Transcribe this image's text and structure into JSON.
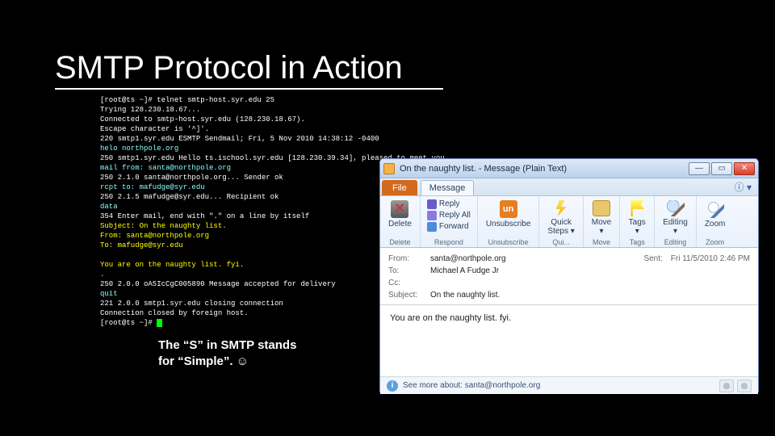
{
  "title": "SMTP Protocol in Action",
  "caption_l1": "The “S” in SMTP stands",
  "caption_l2": "for “Simple”. ☺",
  "terminal": {
    "l01": "[root@ts ~]# telnet smtp-host.syr.edu 25",
    "l02": "Trying 128.230.18.67...",
    "l03": "Connected to smtp-host.syr.edu (128.230.18.67).",
    "l04": "Escape character is '^]'.",
    "l05": "220 smtp1.syr.edu ESMTP Sendmail; Fri, 5 Nov 2010 14:38:12 -0400",
    "l06": "helo northpole.org",
    "l07": "250 smtp1.syr.edu Hello ts.ischool.syr.edu [128.230.39.34], pleased to meet you",
    "l08": "mail from: santa@northpole.org",
    "l09": "250 2.1.0 santa@northpole.org... Sender ok",
    "l10": "rcpt to: mafudge@syr.edu",
    "l11": "250 2.1.5 mafudge@syr.edu... Recipient ok",
    "l12": "data",
    "l13": "354 Enter mail, end with \".\" on a line by itself",
    "l14": "Subject: On the naughty list.",
    "l15": "From: santa@northpole.org",
    "l16": "To: mafudge@syr.edu",
    "l17": "",
    "l18": "You are on the naughty list. fyi.",
    "l19": ".",
    "l20": "250 2.0.0 oA5IcCgC005890 Message accepted for delivery",
    "l21": "quit",
    "l22": "221 2.0.0 smtp1.syr.edu closing connection",
    "l23": "Connection closed by foreign host.",
    "l24": "[root@ts ~]# "
  },
  "outlook": {
    "window_title": "On the naughty list. - Message (Plain Text)",
    "tabs": {
      "file": "File",
      "message": "Message"
    },
    "ribbon": {
      "delete_grp": "Delete",
      "delete": "Delete",
      "respond_grp": "Respond",
      "reply": "Reply",
      "replyall": "Reply All",
      "forward": "Forward",
      "unsub_grp": "Unsubscribe",
      "unsubscribe": "Unsubscribe",
      "qui_grp": "Qui...",
      "quicksteps": "Quick\nSteps ▾",
      "move_grp": "Move",
      "move": "Move\n▾",
      "tags_grp": "Tags",
      "tags": "Tags\n▾",
      "editing_grp": "Editing",
      "editing": "Editing\n▾",
      "zoom_grp": "Zoom",
      "zoom": "Zoom"
    },
    "header": {
      "from_l": "From:",
      "from_v": "santa@northpole.org",
      "to_l": "To:",
      "to_v": "Michael A Fudge Jr",
      "cc_l": "Cc:",
      "cc_v": "",
      "subj_l": "Subject:",
      "subj_v": "On the naughty list.",
      "sent_l": "Sent:",
      "sent_v": "Fri 11/5/2010 2:46 PM"
    },
    "body": "You are on the naughty list. fyi.",
    "infobar": "See more about: santa@northpole.org"
  }
}
